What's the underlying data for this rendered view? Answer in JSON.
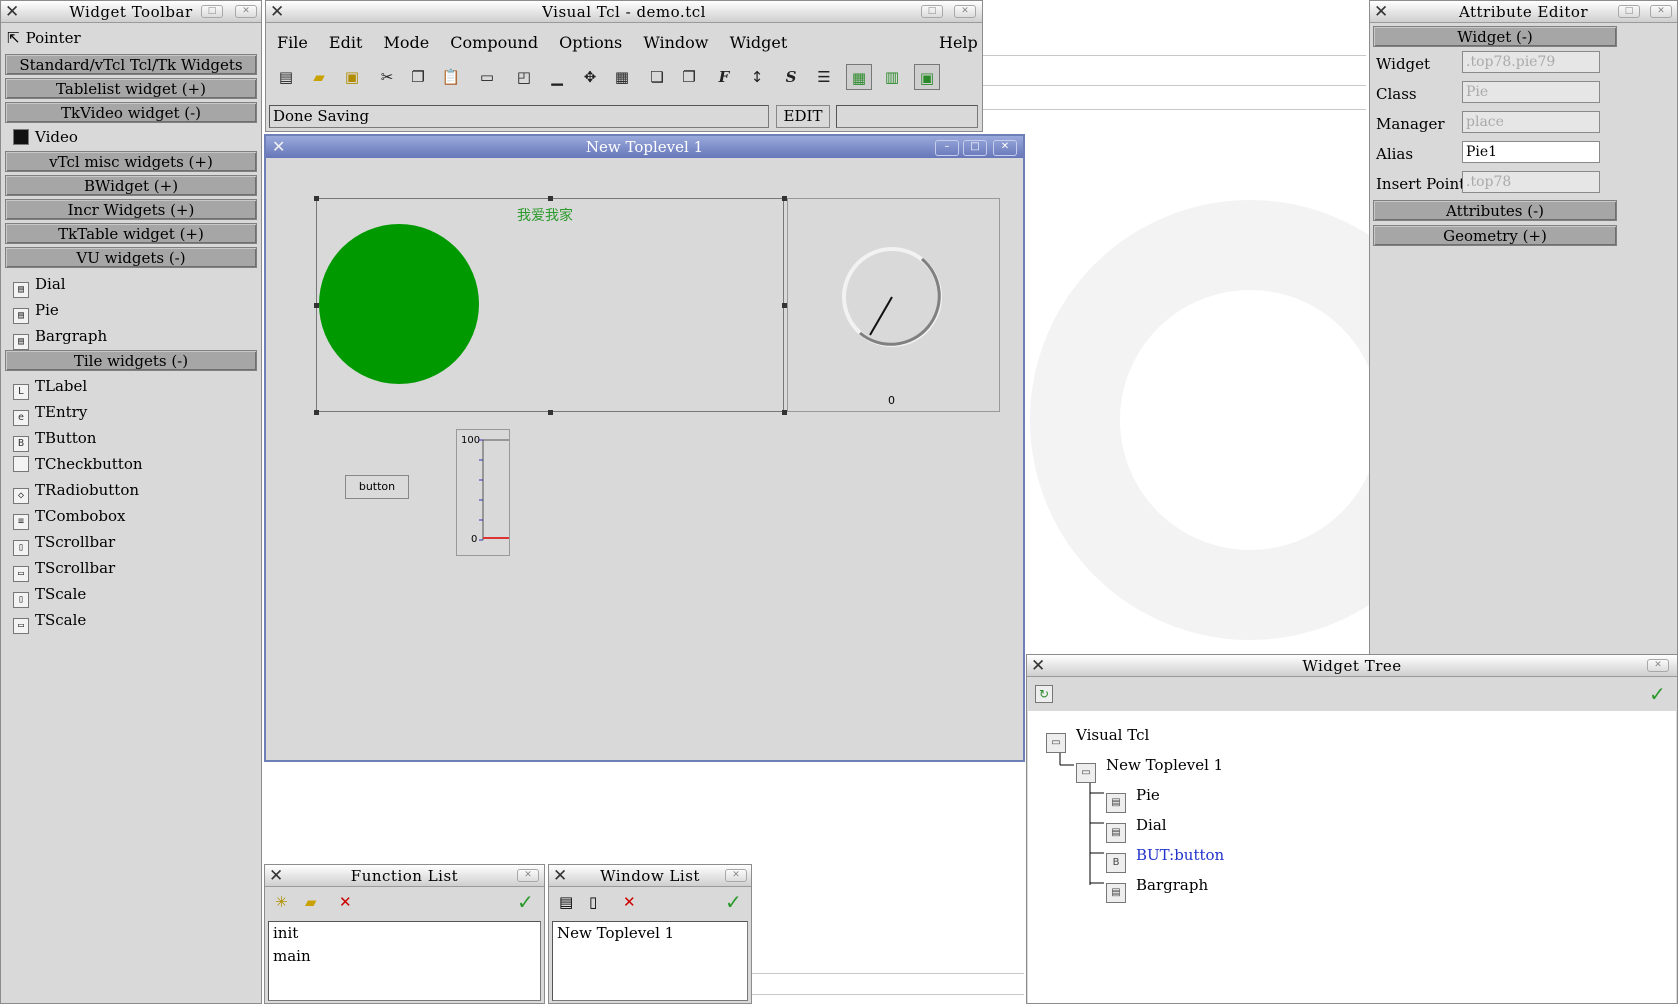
{
  "widget_toolbar": {
    "title": "Widget Toolbar",
    "pointer": "Pointer",
    "sections": [
      "Standard/vTcl Tcl/Tk Widgets (+)",
      "Tablelist widget (+)",
      "TkVideo widget (-)"
    ],
    "video_item": "Video",
    "sections2": [
      "vTcl misc widgets (+)",
      "BWidget (+)",
      "Incr Widgets (+)",
      "TkTable widget (+)",
      "VU widgets (-)"
    ],
    "vu_items": [
      "Dial",
      "Pie",
      "Bargraph"
    ],
    "tile_header": "Tile widgets (-)",
    "tile_items": [
      "TLabel",
      "TEntry",
      "TButton",
      "TCheckbutton",
      "TRadiobutton",
      "TCombobox",
      "TScrollbar",
      "TScrollbar",
      "TScale",
      "TScale"
    ]
  },
  "main": {
    "title": "Visual Tcl - demo.tcl",
    "menu": [
      "File",
      "Edit",
      "Mode",
      "Compound",
      "Options",
      "Window",
      "Widget"
    ],
    "help": "Help",
    "status": "Done Saving",
    "mode": "EDIT"
  },
  "toplevel": {
    "title": "New Toplevel 1",
    "pie_label": "我爱我家",
    "dial_value": "0",
    "button_label": "button",
    "bargraph_max": "100",
    "bargraph_min": "0"
  },
  "attribute_editor": {
    "title": "Attribute Editor",
    "widget_header": "Widget (-)",
    "fields": [
      {
        "label": "Widget",
        "value": ".top78.pie79"
      },
      {
        "label": "Class",
        "value": "Pie"
      },
      {
        "label": "Manager",
        "value": "place"
      },
      {
        "label": "Alias",
        "value": "Pie1"
      },
      {
        "label": "Insert Point",
        "value": ".top78"
      }
    ],
    "attributes_header": "Attributes (-)",
    "geometry_header": "Geometry (+)"
  },
  "widget_tree": {
    "title": "Widget Tree",
    "items": [
      "Visual Tcl",
      "New Toplevel 1",
      "Pie",
      "Dial",
      "BUT:button",
      "Bargraph"
    ]
  },
  "function_list": {
    "title": "Function List",
    "items": [
      "init",
      "main"
    ]
  },
  "window_list": {
    "title": "Window List",
    "items": [
      "New Toplevel 1"
    ]
  }
}
